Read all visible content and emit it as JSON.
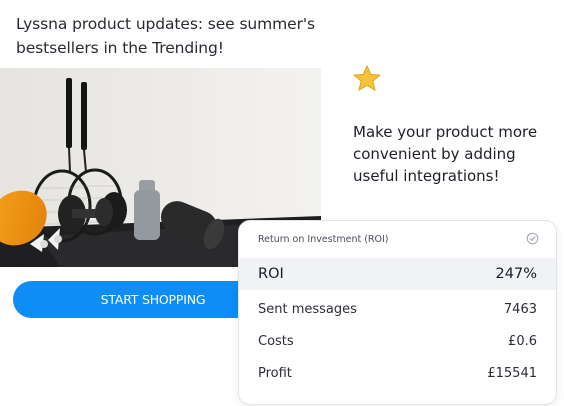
{
  "headline": "Lyssna product updates: see summer's bestsellers in the Trending!",
  "cta_label": "START SHOPPING",
  "promo_text": "Make your product more convenient by adding useful integrations!",
  "icons": {
    "star": "star-icon",
    "check": "check-circle-icon"
  },
  "colors": {
    "accent": "#0e8df5",
    "star": "#f5c23a",
    "highlight_row": "#f1f2f6"
  },
  "roi_card": {
    "title": "Return on Investment (ROI)",
    "rows": [
      {
        "label": "ROI",
        "value": "247%"
      },
      {
        "label": "Sent messages",
        "value": "7463"
      },
      {
        "label": "Costs",
        "value": "£0.6"
      },
      {
        "label": "Profit",
        "value": "£15541"
      }
    ]
  }
}
